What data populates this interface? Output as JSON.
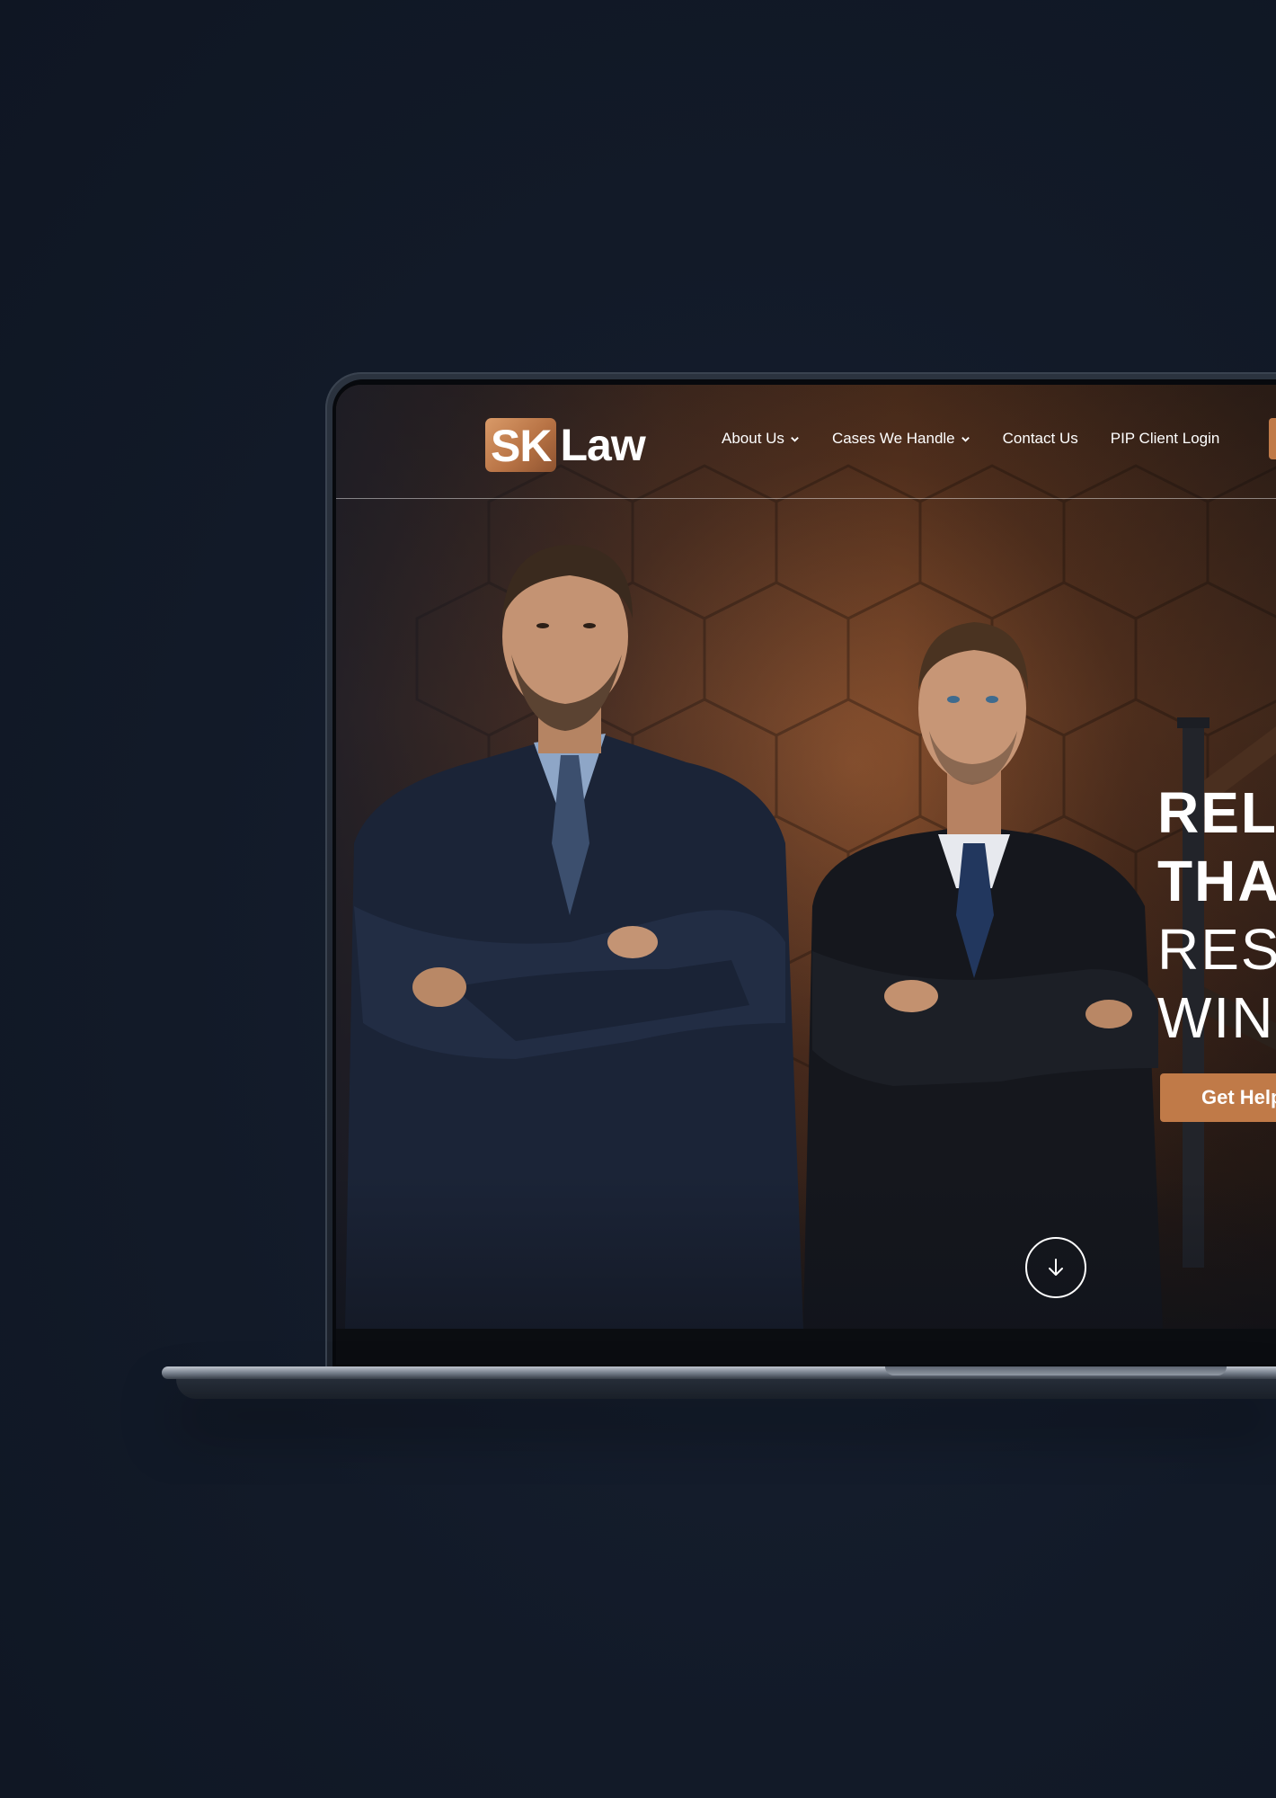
{
  "site": {
    "logo": {
      "badge_text": "SK",
      "wordmark": "Law"
    },
    "nav": {
      "items": [
        {
          "label": "About Us",
          "has_dropdown": true
        },
        {
          "label": "Cases We Handle",
          "has_dropdown": true
        },
        {
          "label": "Contact Us",
          "has_dropdown": false
        },
        {
          "label": "PIP Client Login",
          "has_dropdown": false
        }
      ]
    },
    "hero": {
      "headline_lines": [
        "RELA",
        "THA",
        "RESU",
        "WIN."
      ],
      "cta_label": "Get Help",
      "scroll_icon": "arrow-down-icon"
    }
  },
  "colors": {
    "page_background": "#111827",
    "accent": "#c07a48",
    "text": "#ffffff"
  }
}
